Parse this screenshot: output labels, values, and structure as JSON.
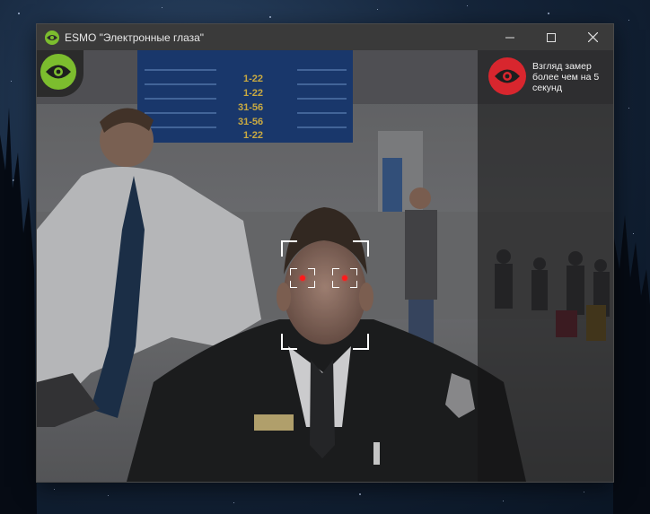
{
  "window": {
    "title": "ESMO \"Электронные глаза\"",
    "controls": {
      "minimize": "minimize",
      "maximize": "maximize",
      "close": "close"
    }
  },
  "camera": {
    "eye_toggle_icon": "eye-icon",
    "eye_toggle_color": "#7cbd2e",
    "face_detected": true,
    "eyes_detected": 2,
    "eye_marker_color": "#ff1a1a"
  },
  "alert": {
    "icon": "eye-icon",
    "color": "#d8262e",
    "message": "Взгляд замер более чем на 5 секунд"
  },
  "board": {
    "rows_left": [
      "1-22",
      "1-22",
      "31-56",
      "31-56",
      "1-22"
    ]
  }
}
